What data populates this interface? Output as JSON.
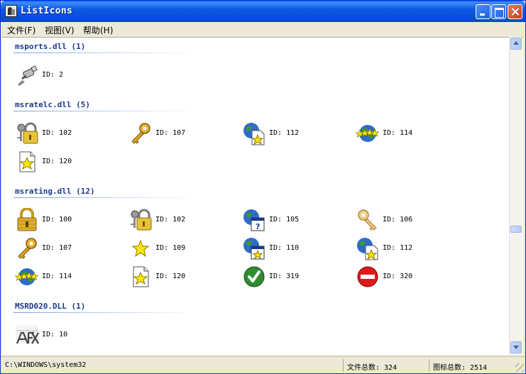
{
  "window": {
    "title": "ListIcons"
  },
  "menu": [
    "文件(F)",
    "视图(V)",
    "帮助(H)"
  ],
  "groups": [
    {
      "title": "msports.dll (1)",
      "items": [
        {
          "icon": "cable-plug-icon",
          "label": "ID: 2"
        }
      ]
    },
    {
      "title": "msratelc.dll (5)",
      "items": [
        {
          "icon": "padlock-keys-icon",
          "label": "ID: 102"
        },
        {
          "icon": "key-icon",
          "label": "ID: 107"
        },
        {
          "icon": "globe-document-star-icon",
          "label": "ID: 112"
        },
        {
          "icon": "globe-stars-icon",
          "label": "ID: 114"
        },
        {
          "icon": "document-star-icon",
          "label": "ID: 120"
        }
      ]
    },
    {
      "title": "msrating.dll (12)",
      "items": [
        {
          "icon": "padlock-icon",
          "label": "ID: 100"
        },
        {
          "icon": "padlock-keys-icon",
          "label": "ID: 102"
        },
        {
          "icon": "globe-window-question-icon",
          "label": "ID: 105"
        },
        {
          "icon": "key-faded-icon",
          "label": "ID: 106"
        },
        {
          "icon": "key-icon",
          "label": "ID: 107"
        },
        {
          "icon": "star-icon",
          "label": "ID: 109"
        },
        {
          "icon": "globe-window-star-icon",
          "label": "ID: 110"
        },
        {
          "icon": "globe-document-star-icon",
          "label": "ID: 112"
        },
        {
          "icon": "globe-stars-icon",
          "label": "ID: 114"
        },
        {
          "icon": "document-star-icon",
          "label": "ID: 120"
        },
        {
          "icon": "green-check-icon",
          "label": "ID: 319"
        },
        {
          "icon": "red-no-entry-icon",
          "label": "ID: 320"
        }
      ]
    },
    {
      "title": "MSRD020.DLL (1)",
      "items": [
        {
          "icon": "microsoft-afx-logo-icon",
          "label": "ID: 10"
        }
      ]
    }
  ],
  "status": {
    "path": "C:\\WINDOWS\\system32",
    "file_count": "文件总数: 324",
    "icon_count": "图标总数: 2514"
  },
  "colors": {
    "title_bar": "#0b50da",
    "group_header": "#1a3a8a",
    "chrome": "#ece9d8"
  }
}
